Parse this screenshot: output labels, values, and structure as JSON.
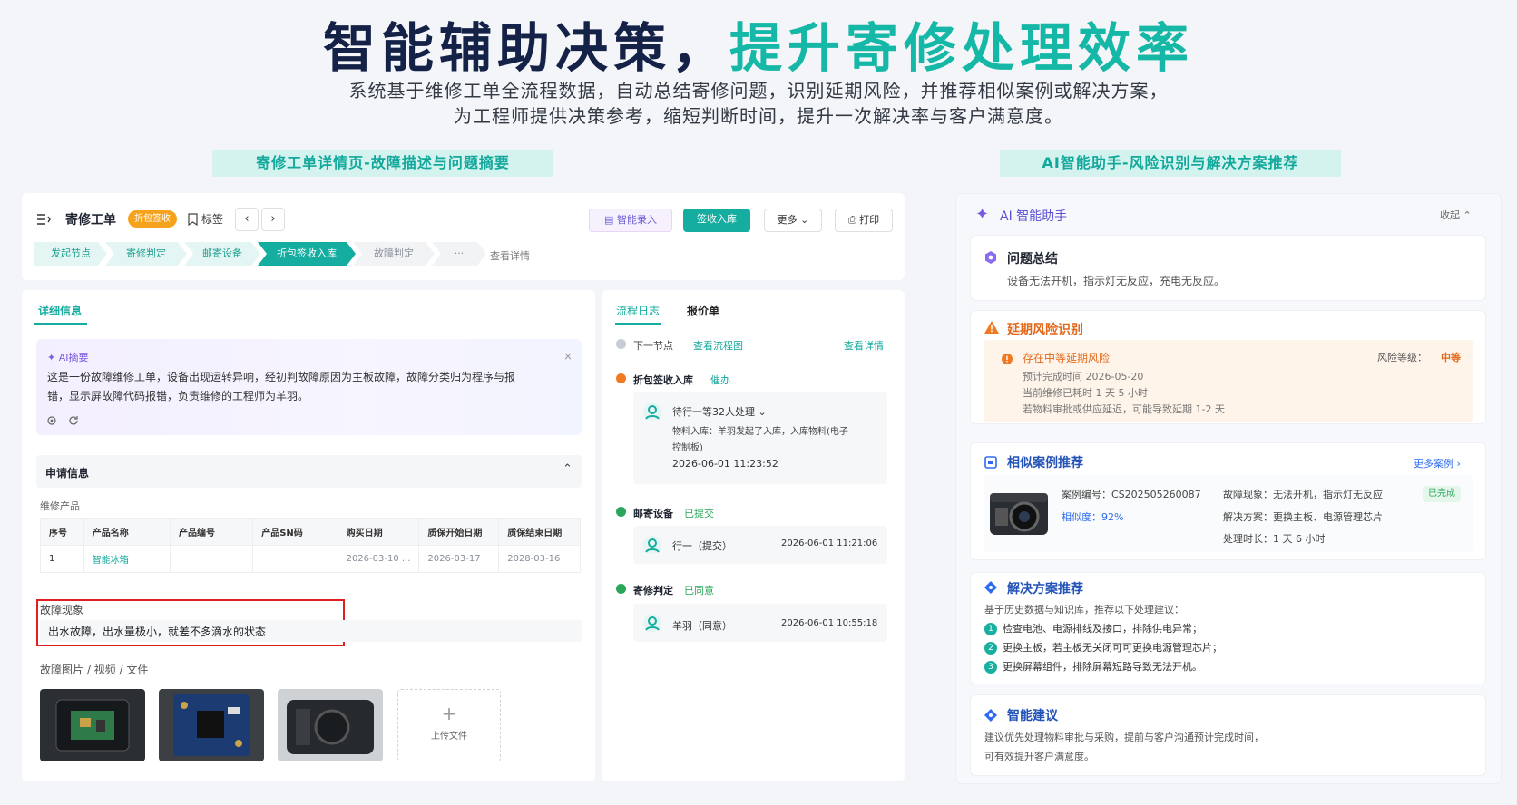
{
  "hero": {
    "title_main": "智能辅助决策，",
    "title_accent": "提升寄修处理效率",
    "subtitle_line1": "系统基于维修工单全流程数据，自动总结寄修问题，识别延期风险，并推荐相似案例或解决方案，",
    "subtitle_line2": "为工程师提供决策参考，缩短判断时间，提升一次解决率与客户满意度。"
  },
  "section_tags": {
    "left": "寄修工单详情页-故障描述与问题摘要",
    "right": "AI智能助手-风险识别与解决方案推荐"
  },
  "order_header": {
    "title": "寄修工单",
    "status_badge": "折包签收",
    "tag_label": "标签",
    "smart_entry_button": "智能录入",
    "receive_button": "签收入库",
    "more_button": "更多",
    "print_button": "打印",
    "breadcrumbs": [
      "发起节点",
      "寄修判定",
      "邮寄设备",
      "折包签收入库",
      "故障判定",
      "···"
    ],
    "view_details": "查看详情"
  },
  "details": {
    "tab_label": "详细信息",
    "ai_summary": {
      "label": "AI摘要",
      "text_line1": "这是一份故障维修工单，设备出现运转异响，经初判故障原因为主板故障，故障分类归为程序与报",
      "text_line2": "错，显示屏故障代码报错，负责维修的工程师为羊羽。"
    },
    "application_info_title": "申请信息",
    "repair_product_label": "维修产品",
    "table": {
      "headers": [
        "序号",
        "产品名称",
        "产品编号",
        "产品SN码",
        "购买日期",
        "质保开始日期",
        "质保结束日期"
      ],
      "rows": [
        [
          "1",
          "智能冰箱",
          "",
          "",
          "2026-03-10 ...",
          "2026-03-17",
          "2028-03-16"
        ]
      ]
    },
    "fault_label": "故障现象",
    "fault_text": "出水故障，出水量极小，就差不多滴水的状态",
    "media_label": "故障图片 / 视频 / 文件",
    "upload_label": "上传文件"
  },
  "log": {
    "tabs": [
      "流程日志",
      "报价单"
    ],
    "next_node_label": "下一节点",
    "view_flow_chart": "查看流程图",
    "view_details": "查看详情",
    "nodes": [
      {
        "title": "折包签收入库",
        "status": "催办",
        "line1": "待行一等32人处理",
        "line2": "物料入库：羊羽发起了入库，入库物料(电子",
        "line3": "控制板)",
        "time": "2026-06-01 11:23:52"
      },
      {
        "title": "邮寄设备",
        "status": "已提交",
        "person": "行一（提交）",
        "time": "2026-06-01 11:21:06"
      },
      {
        "title": "寄修判定",
        "status": "已同意",
        "person": "羊羽（同意）",
        "time": "2026-06-01 10:55:18"
      }
    ]
  },
  "assistant": {
    "title": "AI 智能助手",
    "collapse_label": "收起",
    "summary": {
      "title": "问题总结",
      "text": "设备无法开机，指示灯无反应，充电无反应。"
    },
    "risk": {
      "title": "延期风险识别",
      "headline": "存在中等延期风险",
      "level_label": "风险等级：",
      "level_value": "中等",
      "line1": "预计完成时间 2026-05-20",
      "line2": "当前维修已耗时 1 天 5 小时",
      "line3": "若物料审批或供应延迟，可能导致延期 1-2 天"
    },
    "cases": {
      "title": "相似案例推荐",
      "more_label": "更多案例",
      "case_no_label": "案例编号：",
      "case_no": "CS202505260087",
      "similarity_label": "相似度：",
      "similarity": "92%",
      "symptom_label": "故障现象：",
      "symptom": "无法开机，指示灯无反应",
      "solution_label": "解决方案：",
      "solution": "更换主板、电源管理芯片",
      "duration_label": "处理时长：",
      "duration": "1 天 6 小时",
      "status": "已完成"
    },
    "solutions": {
      "title": "解决方案推荐",
      "intro": "基于历史数据与知识库，推荐以下处理建议：",
      "items": [
        "检查电池、电源排线及接口，排除供电异常；",
        "更换主板，若主板无关闭可可更换电源管理芯片；",
        "更换屏幕组件，排除屏幕短路导致无法开机。"
      ]
    },
    "advice": {
      "title": "智能建议",
      "line1": "建议优先处理物料审批与采购，提前与客户沟通预计完成时间，",
      "line2": "可有效提升客户满意度。"
    }
  },
  "colors": {
    "brand_teal": "#14ad9f",
    "title_navy": "#152247",
    "link_blue": "#2e6bf0",
    "warning_orange": "#f07a22",
    "success_green": "#2aa65b"
  }
}
